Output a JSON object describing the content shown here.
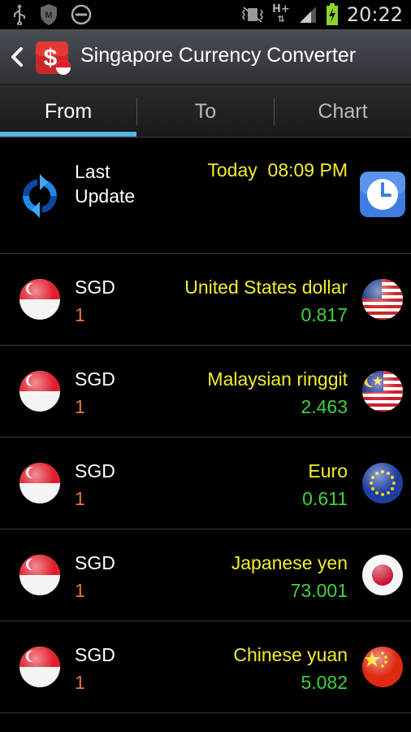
{
  "status_bar": {
    "time": "20:22",
    "network": "H+",
    "left_icons": [
      "usb-icon",
      "antivirus-icon",
      "do-not-disturb-icon"
    ],
    "right_icons": [
      "vibrate-icon",
      "network-type-icon",
      "signal-icon",
      "battery-charging-icon"
    ]
  },
  "action_bar": {
    "title": "Singapore Currency Converter",
    "back_icon": "chevron-left-icon",
    "app_icon": "currency-app-icon"
  },
  "tabs": [
    {
      "label": "From",
      "active": true
    },
    {
      "label": "To",
      "active": false
    },
    {
      "label": "Chart",
      "active": false
    }
  ],
  "last_update": {
    "label": "Last Update",
    "time": "Today  08:09 PM",
    "refresh_icon": "refresh-icon",
    "clock_icon": "clock-icon"
  },
  "rows": [
    {
      "base": "SGD",
      "amount": "1",
      "currency": "United States dollar",
      "rate": "0.817",
      "flag": "us-flag-icon"
    },
    {
      "base": "SGD",
      "amount": "1",
      "currency": "Malaysian ringgit",
      "rate": "2.463",
      "flag": "malaysia-flag-icon"
    },
    {
      "base": "SGD",
      "amount": "1",
      "currency": "Euro",
      "rate": "0.611",
      "flag": "eu-flag-icon"
    },
    {
      "base": "SGD",
      "amount": "1",
      "currency": "Japanese yen",
      "rate": "73.001",
      "flag": "japan-flag-icon"
    },
    {
      "base": "SGD",
      "amount": "1",
      "currency": "Chinese yuan",
      "rate": "5.082",
      "flag": "china-flag-icon"
    }
  ],
  "colors": {
    "currency_name": "#f2ee2c",
    "rate": "#3fd23f",
    "amount": "#e8783a",
    "tab_indicator": "#5ab4e6"
  }
}
